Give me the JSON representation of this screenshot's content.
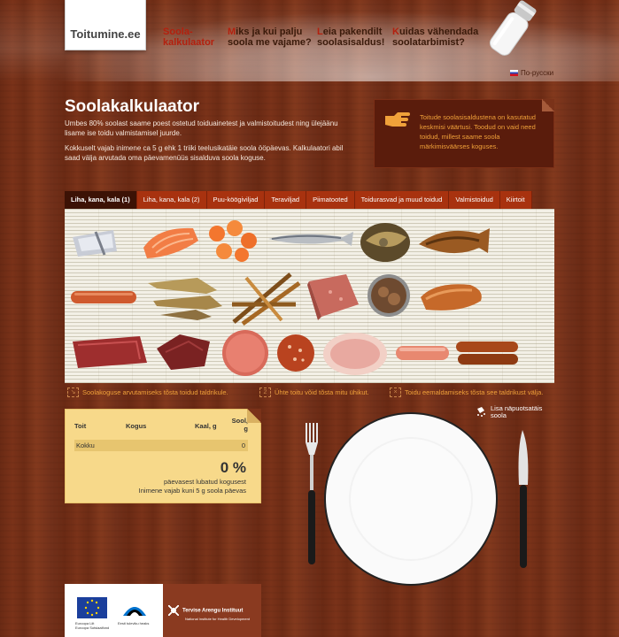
{
  "header": {
    "logo": "Toitumine.ee",
    "nav": [
      {
        "first": "S",
        "line1": "oola-",
        "line2": "kalkulaator"
      },
      {
        "first": "M",
        "line1": "iks ja kui palju",
        "line2": "soola me vajame?"
      },
      {
        "first": "L",
        "line1": "eia pakendilt",
        "line2": "soolasisaldus!"
      },
      {
        "first": "K",
        "line1": "uidas vähendada",
        "line2": "soolatarbimist?"
      }
    ],
    "language_link": "По-русски"
  },
  "intro": {
    "title": "Soolakalkulaator",
    "paragraph1": "Umbes 80% soolast saame poest ostetud toiduainetest ja valmistoitudest ning ülejäänu lisame ise toidu valmistamisel juurde.",
    "paragraph2": "Kokkuselt vajab inimene ca 5 g ehk 1 triiki teelusikatäie soola ööpäevas. Kalkulaatori abil saad välja arvutada oma päevamenüüs sisalduva soola koguse."
  },
  "info_box": {
    "text": "Toitude soolasisaldustena on kasutatud keskmisi väärtusi. Toodud on vaid need toidud, millest saame soola märkimisväärses koguses."
  },
  "tabs": [
    {
      "label": "Liha, kana, kala (1)",
      "active": true
    },
    {
      "label": "Liha, kana, kala (2)",
      "active": false
    },
    {
      "label": "Puu-köögiviljad",
      "active": false
    },
    {
      "label": "Teraviljad",
      "active": false
    },
    {
      "label": "Piimatooted",
      "active": false
    },
    {
      "label": "Toidurasvad ja muud toidud",
      "active": false
    },
    {
      "label": "Valmistoidud",
      "active": false
    },
    {
      "label": "Kiirtoit",
      "active": false
    }
  ],
  "hints": [
    {
      "icon": "drag-icon",
      "text": "Soolakoguse arvutamiseks tõsta toidud taldrikule."
    },
    {
      "icon": "count-2-icon",
      "number": "2",
      "text": "Ühte toitu võid tõsta mitu ühikut."
    },
    {
      "icon": "remove-icon",
      "text": "Toidu eemaldamiseks tõsta see taldrikust välja."
    }
  ],
  "calc_table": {
    "headers": {
      "food": "Toit",
      "amount": "Kogus",
      "weight": "Kaal, g",
      "salt_line1": "Sool,",
      "salt_line2": "g"
    },
    "total_label": "Kokku",
    "total_value": "0",
    "percent": "0 %",
    "percent_label": "päevasest lubatud kogusest",
    "daily_note": "Inimene vajab kuni 5 g soola päevas"
  },
  "salt_add": {
    "line1": "Lisa näpuotsatäis",
    "line2": "soola"
  },
  "footer": {
    "eu_line1": "Euroopa Liit",
    "eu_line2": "Euroopa Sotsiaalfond",
    "ee_text": "Eesti tuleviku heaks",
    "institute": "Tervise Arengu Instituut",
    "institute_sub": "National Institute for Health Development"
  },
  "colors": {
    "accent": "#a8320f",
    "tab_active": "#3c1205",
    "info_text": "#f0a13a",
    "table_bg": "#f7d98a"
  }
}
